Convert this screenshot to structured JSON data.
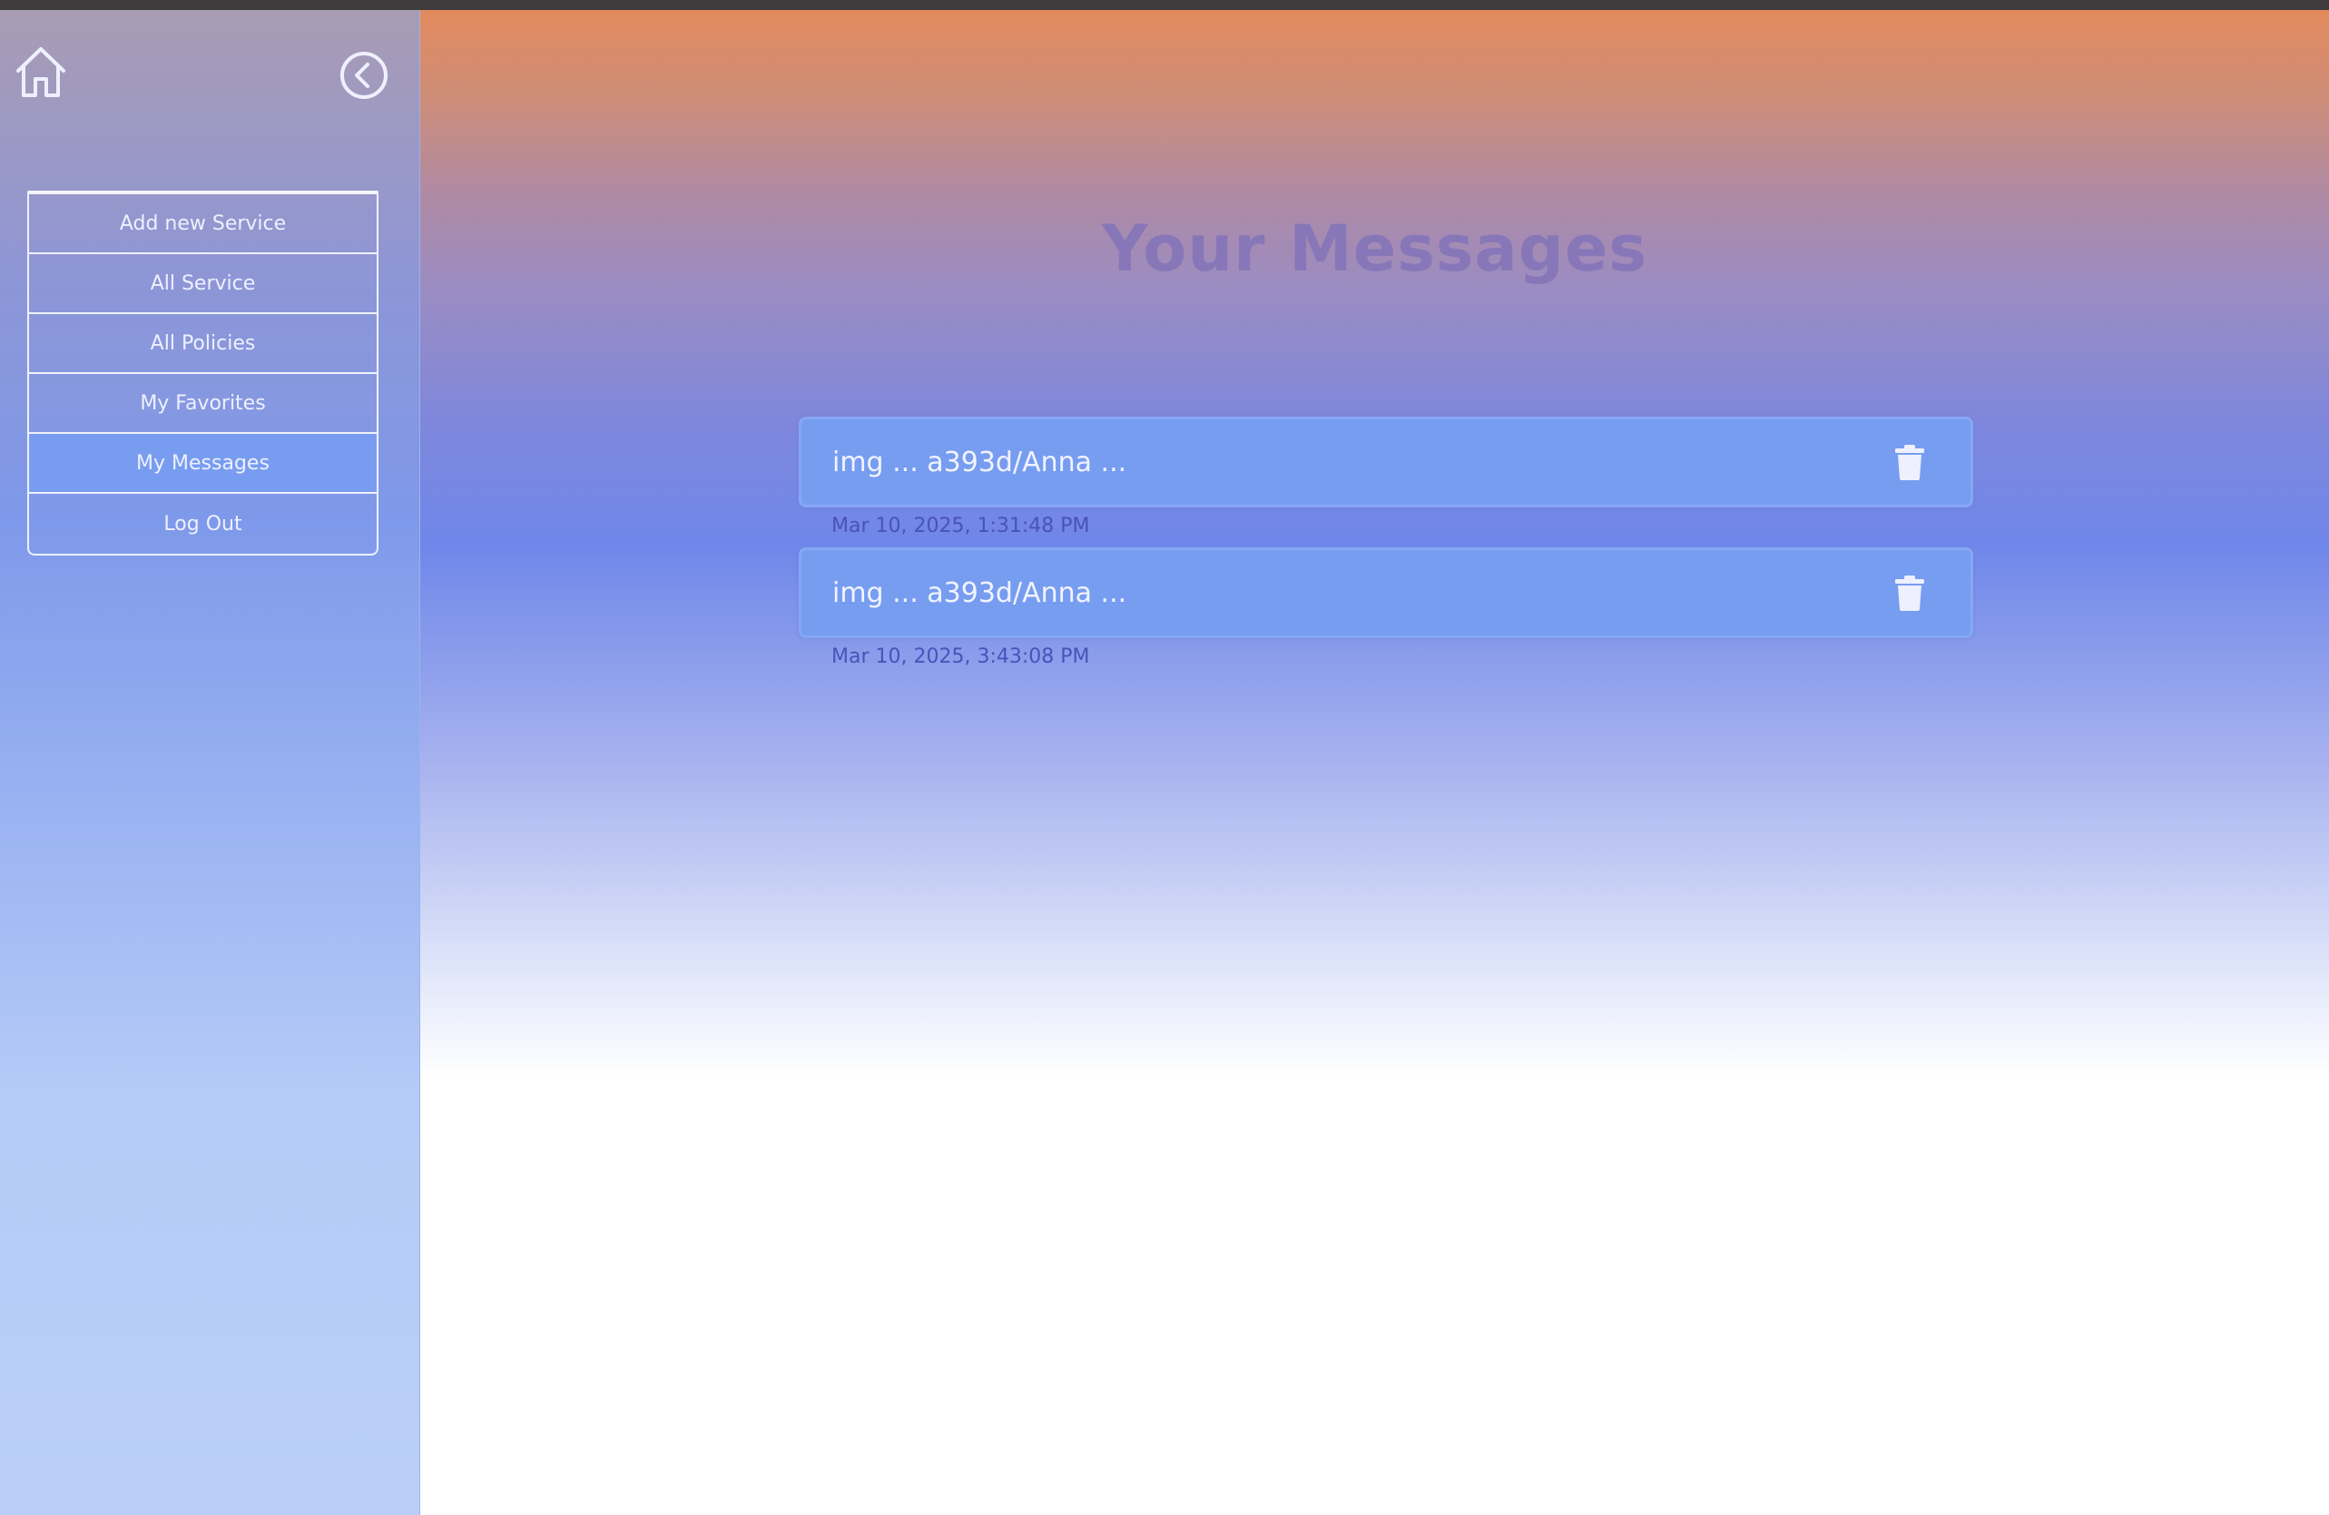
{
  "sidebar": {
    "home_icon": "home-icon",
    "back_icon": "chevron-left-circle-icon",
    "items": [
      {
        "label": "Add new Service",
        "active": false
      },
      {
        "label": "All Service",
        "active": false
      },
      {
        "label": "All Policies",
        "active": false
      },
      {
        "label": "My Favorites",
        "active": false
      },
      {
        "label": "My Messages",
        "active": true
      },
      {
        "label": "Log Out",
        "active": false
      }
    ]
  },
  "main": {
    "title": "Your Messages",
    "messages": [
      {
        "text": "img  ... a393d/Anna ...",
        "date": "Mar 10, 2025, 1:31:48 PM",
        "action_icon": "trash-icon"
      },
      {
        "text": "img  ... a393d/Anna ...",
        "date": "Mar 10, 2025, 3:43:08 PM",
        "action_icon": "trash-icon"
      }
    ]
  },
  "colors": {
    "accent": "#779df0",
    "title": "#8877b8",
    "date_text": "#4a52b8",
    "gradient_top": "#e28a5d"
  }
}
